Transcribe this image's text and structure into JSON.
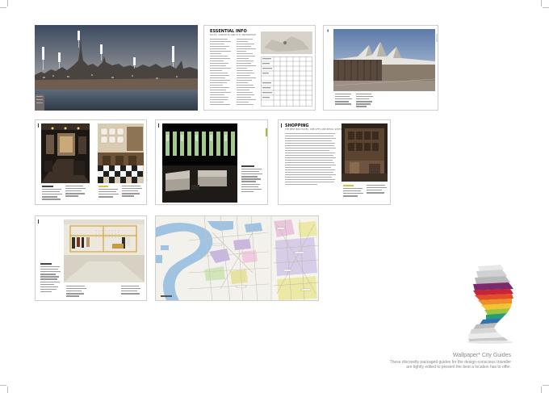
{
  "brand": {
    "title": "Wallpaper* City Guides",
    "line1": "These discreetly packaged guides for the design-conscious traveller",
    "line2": "are tightly edited to present the best a location has to offer."
  },
  "spread_essential": {
    "heading": "ESSENTIAL INFO",
    "subheading": "FACTS, CONTACTS AND CITY KNOWLEDGE"
  },
  "spread_shopping": {
    "heading": "SHOPPING",
    "subheading": "THE BEST BOUTIQUES, ONE-OFFS AND RETAIL SPOTS"
  },
  "colors": {
    "accent_green": "#9bc13b",
    "accent_yellow": "#d7c23b",
    "map_water": "#9fc3e0",
    "map_land": "#f3f1ec"
  }
}
